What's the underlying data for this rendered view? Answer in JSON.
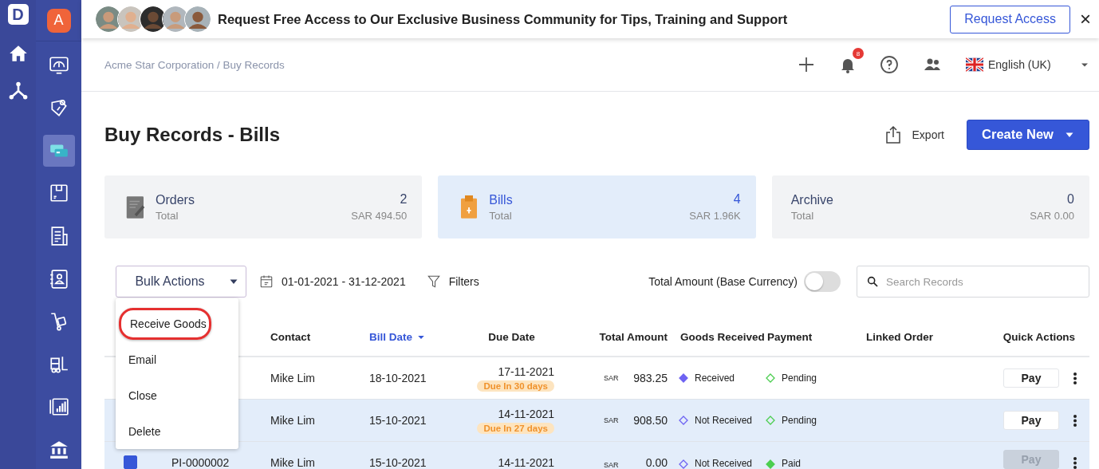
{
  "app_logo": {
    "letter": "D"
  },
  "rail": {
    "items": [
      {
        "kind": "home",
        "selected": false
      },
      {
        "kind": "network",
        "selected": false
      }
    ]
  },
  "org": {
    "initial": "A"
  },
  "sidebar": {
    "items": [
      {
        "kind": "gauge",
        "selected": false
      },
      {
        "kind": "tag",
        "selected": false
      },
      {
        "kind": "cards",
        "selected": true
      },
      {
        "kind": "box",
        "selected": false
      },
      {
        "kind": "list",
        "selected": false
      },
      {
        "kind": "contacts",
        "selected": false
      },
      {
        "kind": "trolley",
        "selected": false
      },
      {
        "kind": "forklift",
        "selected": false
      },
      {
        "kind": "chart",
        "selected": false
      },
      {
        "kind": "bank",
        "selected": false
      }
    ]
  },
  "banner": {
    "text": "Request **Free Access** to Our Exclusive Business Community for Tips, Training and Support",
    "button": "Request Access",
    "close": "×"
  },
  "header": {
    "breadcrumb": "Acme Star Corporation / Buy Records",
    "notifications": "8",
    "language": "English (UK)"
  },
  "page": {
    "title": "Buy Records - Bills",
    "export": "Export",
    "create": "Create New"
  },
  "cards": [
    {
      "kind": "orders",
      "title": "Orders",
      "subtitle": "Total",
      "count": "2",
      "amount": "SAR 494.50",
      "selected": false
    },
    {
      "kind": "bills",
      "title": "Bills",
      "subtitle": "Total",
      "count": "4",
      "amount": "SAR 1.96K",
      "selected": true
    },
    {
      "kind": "archive",
      "title": "Archive",
      "subtitle": "Total",
      "count": "0",
      "amount": "SAR 0.00",
      "selected": false
    }
  ],
  "toolbar": {
    "bulk_actions": "Bulk Actions",
    "date_range": "01-01-2021 - 31-12-2021",
    "filters": "Filters",
    "toggle_label": "Total Amount (Base Currency)",
    "toggle_on": false,
    "search": {
      "placeholder": "Search Records"
    }
  },
  "bulk_menu": {
    "items": [
      {
        "label": "Receive Goods",
        "circled": true
      },
      {
        "label": "Email",
        "circled": false
      },
      {
        "label": "Close",
        "circled": false
      },
      {
        "label": "Delete",
        "circled": false
      }
    ]
  },
  "table": {
    "columns": [
      {
        "label": "Contact",
        "sorted": false
      },
      {
        "label": "Bill Date",
        "sorted": true
      },
      {
        "label": "Due Date",
        "sorted": false
      },
      {
        "label": "Total Amount",
        "sorted": false
      },
      {
        "label": "Goods Received",
        "sorted": false
      },
      {
        "label": "Payment",
        "sorted": false
      },
      {
        "label": "Linked Order",
        "sorted": false
      },
      {
        "label": "Quick Actions",
        "sorted": false
      }
    ],
    "rows": [
      {
        "selected": false,
        "contact": "Mike Lim",
        "bill_date": "18-10-2021",
        "due_date": "17-11-2021",
        "due_badge": "Due In 30 days",
        "currency": "SAR",
        "amount": "983.25",
        "goods": "Received",
        "received": true,
        "payment": "Pending",
        "paid": false,
        "action": "Pay",
        "action_disabled": false
      },
      {
        "selected": true,
        "contact": "Mike Lim",
        "bill_date": "15-10-2021",
        "due_date": "14-11-2021",
        "due_badge": "Due In 27 days",
        "currency": "SAR",
        "amount": "908.50",
        "goods": "Not Received",
        "received": false,
        "payment": "Pending",
        "paid": false,
        "action": "Pay",
        "action_disabled": false
      },
      {
        "selected": true,
        "checked": true,
        "number": "PI-0000002",
        "contact": "Mike Lim",
        "bill_date": "15-10-2021",
        "due_date": "14-11-2021",
        "currency": "SAR",
        "amount": "0.00",
        "goods": "Not Received",
        "received": false,
        "payment": "Paid",
        "paid": true,
        "action": "Pay",
        "action_disabled": true
      }
    ]
  }
}
